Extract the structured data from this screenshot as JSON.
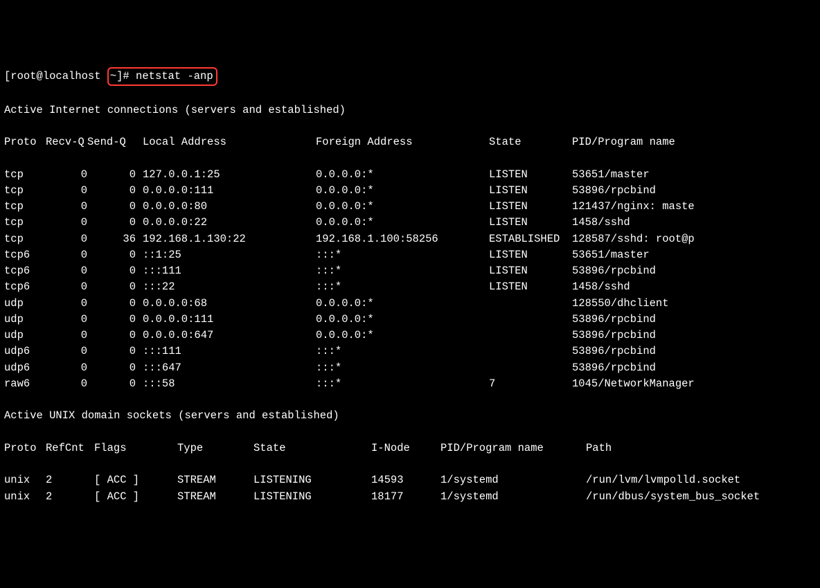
{
  "prompt": {
    "prefix": "[root@localhost ",
    "highlighted": "~]# netstat -anp"
  },
  "section1": "Active Internet connections (servers and established)",
  "inet_header": {
    "proto": "Proto",
    "recvq": "Recv-Q",
    "sendq": "Send-Q",
    "local": "Local Address",
    "foreign": "Foreign Address",
    "state": "State",
    "pid": "PID/Program name"
  },
  "inet_rows": [
    {
      "proto": "tcp",
      "recvq": "0",
      "sendq": "0",
      "local": "127.0.0.1:25",
      "foreign": "0.0.0.0:*",
      "state": "LISTEN",
      "pid": "53651/master"
    },
    {
      "proto": "tcp",
      "recvq": "0",
      "sendq": "0",
      "local": "0.0.0.0:111",
      "foreign": "0.0.0.0:*",
      "state": "LISTEN",
      "pid": "53896/rpcbind"
    },
    {
      "proto": "tcp",
      "recvq": "0",
      "sendq": "0",
      "local": "0.0.0.0:80",
      "foreign": "0.0.0.0:*",
      "state": "LISTEN",
      "pid": "121437/nginx: maste"
    },
    {
      "proto": "tcp",
      "recvq": "0",
      "sendq": "0",
      "local": "0.0.0.0:22",
      "foreign": "0.0.0.0:*",
      "state": "LISTEN",
      "pid": "1458/sshd"
    },
    {
      "proto": "tcp",
      "recvq": "0",
      "sendq": "36",
      "local": "192.168.1.130:22",
      "foreign": "192.168.1.100:58256",
      "state": "ESTABLISHED",
      "pid": "128587/sshd: root@p"
    },
    {
      "proto": "tcp6",
      "recvq": "0",
      "sendq": "0",
      "local": "::1:25",
      "foreign": ":::*",
      "state": "LISTEN",
      "pid": "53651/master"
    },
    {
      "proto": "tcp6",
      "recvq": "0",
      "sendq": "0",
      "local": ":::111",
      "foreign": ":::*",
      "state": "LISTEN",
      "pid": "53896/rpcbind"
    },
    {
      "proto": "tcp6",
      "recvq": "0",
      "sendq": "0",
      "local": ":::22",
      "foreign": ":::*",
      "state": "LISTEN",
      "pid": "1458/sshd"
    },
    {
      "proto": "udp",
      "recvq": "0",
      "sendq": "0",
      "local": "0.0.0.0:68",
      "foreign": "0.0.0.0:*",
      "state": "",
      "pid": "128550/dhclient"
    },
    {
      "proto": "udp",
      "recvq": "0",
      "sendq": "0",
      "local": "0.0.0.0:111",
      "foreign": "0.0.0.0:*",
      "state": "",
      "pid": "53896/rpcbind"
    },
    {
      "proto": "udp",
      "recvq": "0",
      "sendq": "0",
      "local": "0.0.0.0:647",
      "foreign": "0.0.0.0:*",
      "state": "",
      "pid": "53896/rpcbind"
    },
    {
      "proto": "udp6",
      "recvq": "0",
      "sendq": "0",
      "local": ":::111",
      "foreign": ":::*",
      "state": "",
      "pid": "53896/rpcbind"
    },
    {
      "proto": "udp6",
      "recvq": "0",
      "sendq": "0",
      "local": ":::647",
      "foreign": ":::*",
      "state": "",
      "pid": "53896/rpcbind"
    },
    {
      "proto": "raw6",
      "recvq": "0",
      "sendq": "0",
      "local": ":::58",
      "foreign": ":::*",
      "state": "7",
      "pid": "1045/NetworkManager"
    }
  ],
  "section2": "Active UNIX domain sockets (servers and established)",
  "unix_header": {
    "proto": "Proto",
    "refcnt": "RefCnt",
    "flags": "Flags",
    "type": "Type",
    "state": "State",
    "inode": "I-Node",
    "pid": "PID/Program name",
    "path": "Path"
  },
  "unix_rows": [
    {
      "proto": "unix",
      "refcnt": "2",
      "flags": "[ ACC ]",
      "type": "STREAM",
      "state": "LISTENING",
      "inode": "14593",
      "pid": "1/systemd",
      "path": "/run/lvm/lvmpolld.socket"
    },
    {
      "proto": "unix",
      "refcnt": "2",
      "flags": "[ ACC ]",
      "type": "STREAM",
      "state": "LISTENING",
      "inode": "18177",
      "pid": "1/systemd",
      "path": "/run/dbus/system_bus_socket"
    }
  ]
}
